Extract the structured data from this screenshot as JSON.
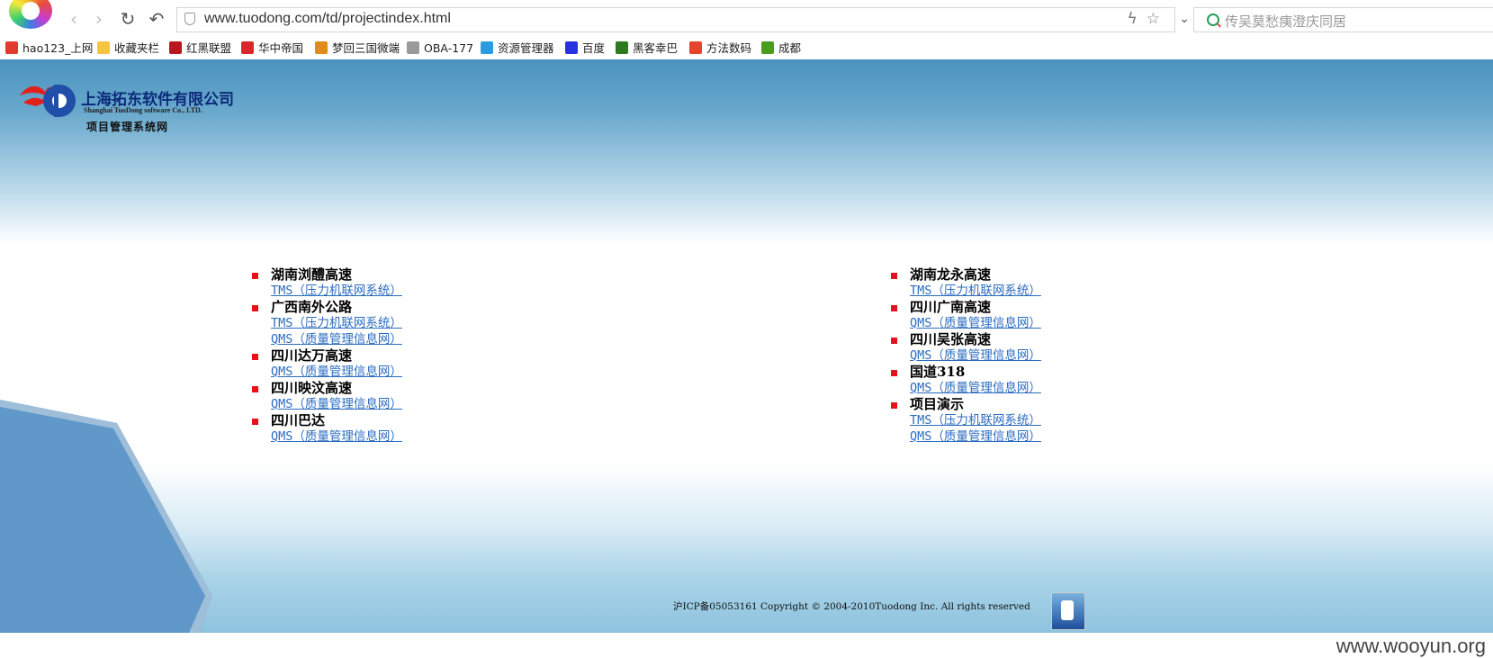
{
  "browser": {
    "url": "www.tuodong.com/td/projectindex.html",
    "search_placeholder": "传吴莫愁痍澄庆同居"
  },
  "bookmarks": [
    {
      "label": "hao123_上网",
      "icon": "hao123-icon",
      "color": "#e23b2e"
    },
    {
      "label": "收藏夹栏",
      "icon": "folder-icon",
      "color": "#f5c542"
    },
    {
      "label": "红黑联盟",
      "icon": "shield-icon",
      "color": "#b8171f"
    },
    {
      "label": "华中帝国",
      "icon": "red-cloud-icon",
      "color": "#d9282b"
    },
    {
      "label": "梦回三国微端",
      "icon": "game-icon",
      "color": "#e28a1b"
    },
    {
      "label": "OBA-177",
      "icon": "page-icon",
      "color": "#9a9a9a"
    },
    {
      "label": "资源管理器",
      "icon": "globe-icon",
      "color": "#2b9be0"
    },
    {
      "label": "百度",
      "icon": "baidu-paw-icon",
      "color": "#2932e1"
    },
    {
      "label": "黑客幸巴",
      "icon": "tree-icon",
      "color": "#2d7a1f"
    },
    {
      "label": "方法数码",
      "icon": "diamond-icon",
      "color": "#e8432e"
    },
    {
      "label": "成都",
      "icon": "green-square-icon",
      "color": "#4a9c1c"
    }
  ],
  "logo": {
    "company": "上海拓东软件有限公司",
    "company_en": "Shanghai TuoDong software Co., LTD.",
    "subtitle": "项目管理系统网"
  },
  "projects_left": [
    {
      "name": "湖南浏醴高速",
      "links": [
        "TMS（压力机联网系统）"
      ]
    },
    {
      "name": "广西南外公路",
      "links": [
        "TMS（压力机联网系统）",
        "QMS（质量管理信息网）"
      ]
    },
    {
      "name": "四川达万高速",
      "links": [
        "QMS（质量管理信息网）"
      ]
    },
    {
      "name": "四川映汶高速",
      "links": [
        "QMS（质量管理信息网）"
      ]
    },
    {
      "name": "四川巴达",
      "links": [
        "QMS（质量管理信息网）"
      ]
    }
  ],
  "projects_right": [
    {
      "name": "湖南龙永高速",
      "links": [
        "TMS（压力机联网系统）"
      ]
    },
    {
      "name": "四川广南高速",
      "links": [
        "QMS（质量管理信息网）"
      ]
    },
    {
      "name": "四川吴张高速",
      "links": [
        "QMS（质量管理信息网）"
      ]
    },
    {
      "name": "国道318",
      "links": [
        "QMS（质量管理信息网）"
      ]
    },
    {
      "name": "项目演示",
      "links": [
        "TMS（压力机联网系统）",
        "QMS（质量管理信息网）"
      ]
    }
  ],
  "footer": {
    "text": "沪ICP备05053161 Copyright © 2004-2010Tuodong Inc. All rights reserved"
  },
  "watermark": "www.wooyun.org"
}
